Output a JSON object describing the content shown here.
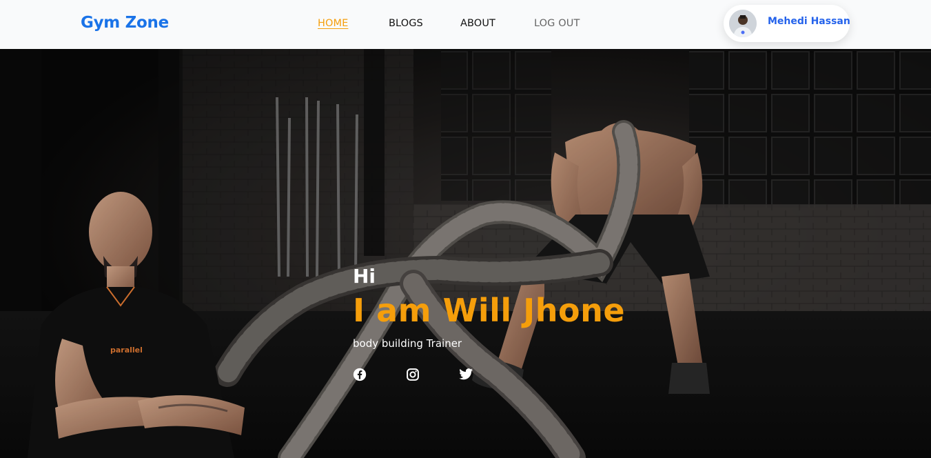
{
  "brand": {
    "name": "Gym Zone"
  },
  "nav": {
    "items": [
      {
        "label": "HOME",
        "state": "active"
      },
      {
        "label": "BLOGS",
        "state": "default"
      },
      {
        "label": "ABOUT",
        "state": "default"
      },
      {
        "label": "LOG OUT",
        "state": "muted"
      }
    ]
  },
  "user": {
    "name": "Mehedi Hassan",
    "avatar_icon": "user-avatar-photo"
  },
  "hero": {
    "greeting": "Hi",
    "headline": "I am Will Jhone",
    "subtitle": "body building Trainer",
    "social": [
      {
        "icon": "facebook-icon"
      },
      {
        "icon": "instagram-icon"
      },
      {
        "icon": "twitter-icon"
      }
    ]
  },
  "colors": {
    "brand": "#1a73e8",
    "accent": "#f59e0b",
    "navbar_bg": "#f9fafb",
    "profile_name": "#2563eb"
  }
}
